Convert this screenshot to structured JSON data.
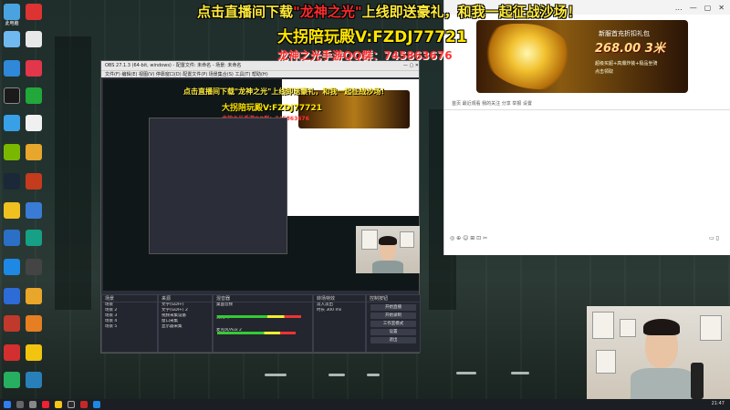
{
  "overlay": {
    "banner_prefix": "点击直播间下载",
    "banner_game": "\"龙神之光\"",
    "banner_suffix": "上线即送豪礼，和我一起征战沙场！",
    "promo_line1": "大拐陪玩殿V:FZDJ77721",
    "promo_line2_label": "龙神之光手游QQ群：",
    "promo_line2_number": "745863676"
  },
  "ad": {
    "title": "新服首充折扣礼包",
    "price": "268.00",
    "unit": "3米",
    "lines": [
      "超级买超+高爆炸装+极品坐骑",
      "点击领取"
    ]
  },
  "browser": {
    "toolbar_text": "首页  最近观看  我的关注  分享  举报  设置",
    "bottom_left": "◎ ⊕ ☺ ⊞ ⊡ ✂",
    "bottom_right": "▭ ▯",
    "titlebar_icons": [
      "…",
      "—",
      "▢",
      "✕"
    ]
  },
  "obs": {
    "title": "OBS 27.1.3 (64-bit, windows) - 配置文件: 未命名 - 场景: 未命名",
    "menu": "文件(F)  编辑(E)  视图(V)  停靠窗口(D)  配置文件(P)  场景集合(S)  工具(T)  帮助(H)",
    "docks": {
      "scenes": {
        "header": "场景",
        "items": [
          "场景",
          "场景 2",
          "场景 3",
          "场景 4",
          "场景 5"
        ]
      },
      "sources": {
        "header": "来源",
        "items": [
          "文字(GDI+)",
          "文字(GDI+) 2",
          "视频采集设备",
          "窗口采集",
          "显示器采集"
        ]
      },
      "mixer": {
        "header": "混音器",
        "items": [
          "桌面音频",
          "麦克风/Aux",
          "麦克风/Aux 2"
        ]
      },
      "transitions": {
        "header": "转场特效",
        "items": [
          "淡入淡出",
          "时长 300 ms"
        ]
      },
      "controls": {
        "header": "控制按钮",
        "buttons": [
          "开始直播",
          "开始录制",
          "工作室模式",
          "设置",
          "退出"
        ]
      }
    }
  },
  "nested": {
    "banner": "点击直播间下载\"龙神之光\"上线即送豪礼，和我一起征战沙场！",
    "promo1": "大拐陪玩殿V:FZDJ77721",
    "promo2": "龙神之光手游QQ群：745863676"
  },
  "desktop_icons": [
    "此电脑",
    "网易",
    "Chrome",
    "回收站",
    "Edge",
    "哔哩哔哩",
    "QQ",
    "WPS",
    "微信",
    "NVIDIA",
    "文档",
    "Steam",
    "Office",
    "网易云",
    "抖音",
    "腾讯会议",
    "QQ音乐",
    "百度网盘",
    "剪映",
    "OBS",
    "YY",
    "虎牙",
    "快手",
    "游戏"
  ],
  "taskbar": {
    "clock": "21:47"
  }
}
